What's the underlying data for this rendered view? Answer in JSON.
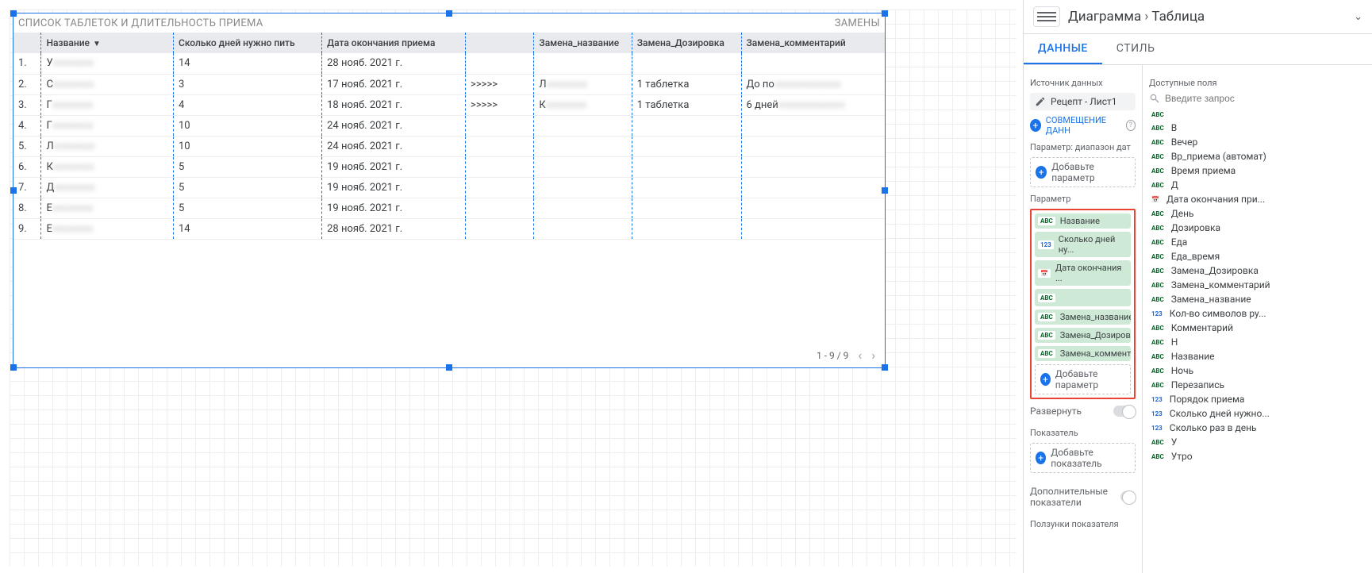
{
  "chart": {
    "title_left": "СПИСОК ТАБЛЕТОК И ДЛИТЕЛЬНОСТЬ ПРИЕМА",
    "title_right": "ЗАМЕНЫ",
    "columns": {
      "name": "Название",
      "days": "Сколько дней нужно пить",
      "end": "Дата окончания приема",
      "arrow": "",
      "zname": "Замена_название",
      "zdose": "Замена_Дозировка",
      "zcomment": "Замена_комментарий"
    },
    "rows": [
      {
        "n": "1.",
        "name": "У",
        "days": "14",
        "end": "28 нояб. 2021 г.",
        "arrow": "",
        "zn": "",
        "zd": "",
        "zc": ""
      },
      {
        "n": "2.",
        "name": "С",
        "days": "3",
        "end": "17 нояб. 2021 г.",
        "arrow": ">>>>>",
        "zn": "Л",
        "zd": "1 таблетка",
        "zc": "До по"
      },
      {
        "n": "3.",
        "name": "Г",
        "days": "4",
        "end": "18 нояб. 2021 г.",
        "arrow": ">>>>>",
        "zn": "К",
        "zd": "1 таблетка",
        "zc": "6 дней"
      },
      {
        "n": "4.",
        "name": "Г",
        "days": "10",
        "end": "24 нояб. 2021 г.",
        "arrow": "",
        "zn": "",
        "zd": "",
        "zc": ""
      },
      {
        "n": "5.",
        "name": "Л",
        "days": "10",
        "end": "24 нояб. 2021 г.",
        "arrow": "",
        "zn": "",
        "zd": "",
        "zc": ""
      },
      {
        "n": "6.",
        "name": "К",
        "days": "5",
        "end": "19 нояб. 2021 г.",
        "arrow": "",
        "zn": "",
        "zd": "",
        "zc": ""
      },
      {
        "n": "7.",
        "name": "Д",
        "days": "5",
        "end": "19 нояб. 2021 г.",
        "arrow": "",
        "zn": "",
        "zd": "",
        "zc": ""
      },
      {
        "n": "8.",
        "name": "Е",
        "days": "5",
        "end": "19 нояб. 2021 г.",
        "arrow": "",
        "zn": "",
        "zd": "",
        "zc": ""
      },
      {
        "n": "9.",
        "name": "Е",
        "days": "14",
        "end": "28 нояб. 2021 г.",
        "arrow": "",
        "zn": "",
        "zd": "",
        "zc": ""
      }
    ],
    "pager": "1 - 9 / 9"
  },
  "panel": {
    "crumb_chart": "Диаграмма",
    "crumb_type": "Таблица",
    "tab_data": "ДАННЫЕ",
    "tab_style": "СТИЛЬ",
    "sec_source": "Источник данных",
    "source_name": "Рецепт - Лист1",
    "blend_label": "СОВМЕЩЕНИЕ ДАНН",
    "sec_daterange": "Параметр: диапазон дат",
    "add_param": "Добавьте параметр",
    "sec_param": "Параметр",
    "dims": [
      {
        "t": "ABC",
        "label": "Название"
      },
      {
        "t": "123",
        "label": "Сколько дней ну..."
      },
      {
        "t": "date",
        "label": "Дата окончания ..."
      },
      {
        "t": "ABC",
        "label": ""
      },
      {
        "t": "ABC",
        "label": "Замена_название"
      },
      {
        "t": "ABC",
        "label": "Замена_Дозиров..."
      },
      {
        "t": "ABC",
        "label": "Замена_коммент..."
      }
    ],
    "deploy": "Развернуть",
    "sec_metric": "Показатель",
    "add_metric": "Добавьте показатель",
    "sec_extra_metric": "Дополнительные показатели",
    "sec_sliders": "Ползунки показателя",
    "sec_available": "Доступные поля",
    "search_ph": "Введите запрос",
    "fields": [
      {
        "t": "abc",
        "label": ""
      },
      {
        "t": "abc",
        "label": "В"
      },
      {
        "t": "abc",
        "label": "Вечер"
      },
      {
        "t": "abc",
        "label": "Вр_приема (автомат)"
      },
      {
        "t": "abc",
        "label": "Время приема"
      },
      {
        "t": "abc",
        "label": "Д"
      },
      {
        "t": "date",
        "label": "Дата окончания при..."
      },
      {
        "t": "abc",
        "label": "День"
      },
      {
        "t": "abc",
        "label": "Дозировка"
      },
      {
        "t": "abc",
        "label": "Еда"
      },
      {
        "t": "abc",
        "label": "Еда_время"
      },
      {
        "t": "abc",
        "label": "Замена_Дозировка"
      },
      {
        "t": "abc",
        "label": "Замена_комментарий"
      },
      {
        "t": "abc",
        "label": "Замена_название"
      },
      {
        "t": "num",
        "label": "Кол-во символов ру..."
      },
      {
        "t": "abc",
        "label": "Комментарий"
      },
      {
        "t": "abc",
        "label": "Н"
      },
      {
        "t": "abc",
        "label": "Название"
      },
      {
        "t": "abc",
        "label": "Ночь"
      },
      {
        "t": "abc",
        "label": "Перезапись"
      },
      {
        "t": "num",
        "label": "Порядок приема"
      },
      {
        "t": "num",
        "label": "Сколько дней нужно..."
      },
      {
        "t": "num",
        "label": "Сколько раз в день"
      },
      {
        "t": "abc",
        "label": "У"
      },
      {
        "t": "abc",
        "label": "Утро"
      }
    ]
  }
}
